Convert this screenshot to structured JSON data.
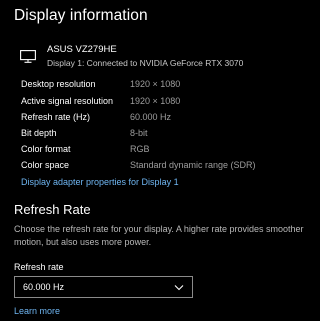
{
  "header": {
    "title": "Display information"
  },
  "monitor": {
    "icon": "monitor-icon",
    "name": "ASUS VZ279HE",
    "subtitle": "Display 1: Connected to NVIDIA GeForce RTX 3070"
  },
  "info": [
    {
      "label": "Desktop resolution",
      "value": "1920 × 1080"
    },
    {
      "label": "Active signal resolution",
      "value": "1920 × 1080"
    },
    {
      "label": "Refresh rate (Hz)",
      "value": "60.000 Hz"
    },
    {
      "label": "Bit depth",
      "value": "8-bit"
    },
    {
      "label": "Color format",
      "value": "RGB"
    },
    {
      "label": "Color space",
      "value": "Standard dynamic range (SDR)"
    }
  ],
  "adapter_link": "Display adapter properties for Display 1",
  "refresh_section": {
    "title": "Refresh Rate",
    "description": "Choose the refresh rate for your display. A higher rate provides smoother motion, but also uses more power.",
    "dropdown_label": "Refresh rate",
    "dropdown_value": "60.000 Hz",
    "learn_more": "Learn more"
  },
  "colors": {
    "background": "#000000",
    "text": "#ffffff",
    "secondary_text": "#9e9e9e",
    "link": "#6fb6f2"
  }
}
